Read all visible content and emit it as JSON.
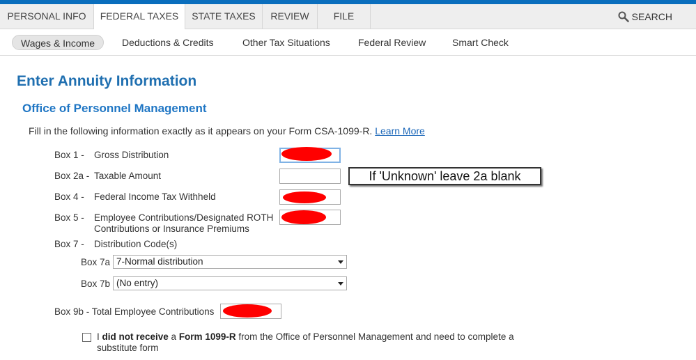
{
  "main_nav": {
    "tabs": [
      {
        "label": "PERSONAL INFO"
      },
      {
        "label": "FEDERAL TAXES"
      },
      {
        "label": "STATE TAXES"
      },
      {
        "label": "REVIEW"
      },
      {
        "label": "FILE"
      }
    ],
    "active_tab": "FEDERAL TAXES",
    "search_label": "SEARCH",
    "search_icon": "magnifier-icon"
  },
  "sub_nav": {
    "tabs": [
      {
        "label": "Wages & Income"
      },
      {
        "label": "Deductions & Credits"
      },
      {
        "label": "Other Tax Situations"
      },
      {
        "label": "Federal Review"
      },
      {
        "label": "Smart Check"
      }
    ],
    "active_tab": "Wages & Income"
  },
  "page": {
    "title": "Enter Annuity Information",
    "section_title": "Office of Personnel Management",
    "intro_text": "Fill in the following information exactly as it appears on your Form CSA-1099-R.",
    "learn_more": "Learn More"
  },
  "form": {
    "box1": {
      "box": "Box 1 -",
      "label": "Gross Distribution"
    },
    "box2a": {
      "box": "Box 2a -",
      "label": "Taxable Amount"
    },
    "box4": {
      "box": "Box 4 -",
      "label": "Federal Income Tax Withheld"
    },
    "box5": {
      "box": "Box 5 -",
      "label_line1": "Employee Contributions/Designated ROTH",
      "label_line2": "Contributions or Insurance Premiums"
    },
    "box7": {
      "box": "Box 7 -",
      "label": "Distribution Code(s)"
    },
    "box7a": {
      "label": "Box 7a",
      "selected": "7-Normal distribution"
    },
    "box7b": {
      "label": "Box 7b",
      "selected": "(No entry)"
    },
    "box9b": {
      "label": "Box 9b - Total Employee Contributions"
    }
  },
  "annotation": {
    "text": "If 'Unknown' leave 2a blank"
  },
  "checkbox": {
    "part1": "I ",
    "bold1": "did not receive",
    "part2": " a ",
    "bold2": "Form 1099-R",
    "part3": " from the Office of Personnel Management and need to complete a substitute form",
    "checked": false
  },
  "colors": {
    "brand_blue": "#0a6ebd",
    "title_blue": "#1f6fb0",
    "redaction": "#ff0000"
  }
}
